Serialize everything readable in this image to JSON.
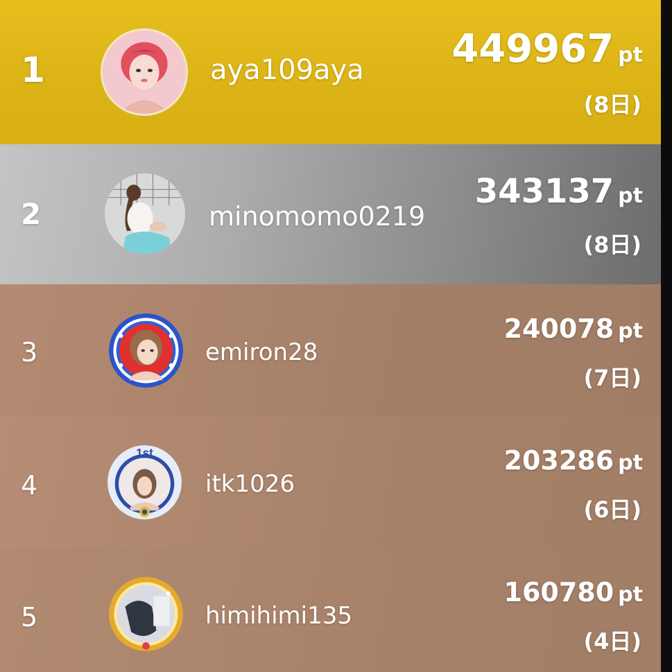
{
  "leaderboard": {
    "unit": "pt",
    "entries": [
      {
        "rank": "1",
        "username": "aya109aya",
        "points": "449967",
        "days": "(8日)",
        "tier": "gold"
      },
      {
        "rank": "2",
        "username": "minomomo0219",
        "points": "343137",
        "days": "(8日)",
        "tier": "silver"
      },
      {
        "rank": "3",
        "username": "emiron28",
        "points": "240078",
        "days": "(7日)",
        "tier": "bronze"
      },
      {
        "rank": "4",
        "username": "itk1026",
        "points": "203286",
        "days": "(6日)",
        "tier": "bronze"
      },
      {
        "rank": "5",
        "username": "himihimi135",
        "points": "160780",
        "days": "(4日)",
        "tier": "bronze"
      }
    ]
  },
  "colors": {
    "gold_row": "#dcb416",
    "silver_row": "#a4a4a6",
    "bronze_row": "#a67f67",
    "text": "#ffffff"
  },
  "icons": {
    "avatar_frame_3": "blue-star-frame-icon",
    "avatar_frame_4": "1st-badge-frame-icon",
    "avatar_frame_5": "gold-ring-frame-icon"
  }
}
